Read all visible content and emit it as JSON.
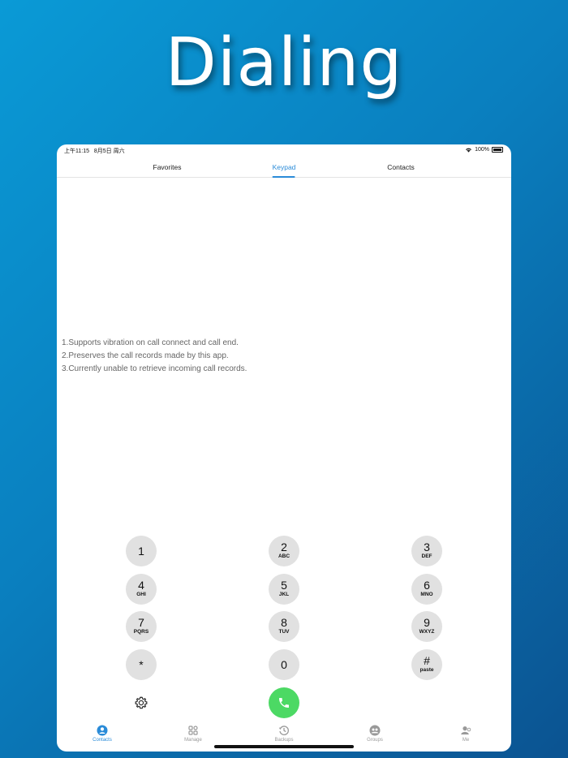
{
  "headline": "Dialing",
  "status": {
    "time": "上午11:15",
    "date": "8月5日 周六",
    "battery": "100%"
  },
  "tabs": [
    {
      "label": "Favorites",
      "active": false
    },
    {
      "label": "Keypad",
      "active": true
    },
    {
      "label": "Contacts",
      "active": false
    }
  ],
  "notes": [
    "1.Supports vibration on call connect and call end.",
    "2.Preserves the call records made by this app.",
    "3.Currently unable to retrieve incoming call records."
  ],
  "keypad": [
    {
      "digit": "1",
      "letters": ""
    },
    {
      "digit": "2",
      "letters": "ABC"
    },
    {
      "digit": "3",
      "letters": "DEF"
    },
    {
      "digit": "4",
      "letters": "GHI"
    },
    {
      "digit": "5",
      "letters": "JKL"
    },
    {
      "digit": "6",
      "letters": "MNO"
    },
    {
      "digit": "7",
      "letters": "PQRS"
    },
    {
      "digit": "8",
      "letters": "TUV"
    },
    {
      "digit": "9",
      "letters": "WXYZ"
    },
    {
      "digit": "*",
      "letters": ""
    },
    {
      "digit": "0",
      "letters": ""
    },
    {
      "digit": "#",
      "letters": "paste"
    }
  ],
  "tabbar": [
    {
      "label": "Contacts",
      "icon": "person-circle-icon",
      "active": true
    },
    {
      "label": "Manage",
      "icon": "grid-icon",
      "active": false
    },
    {
      "label": "Backups",
      "icon": "history-icon",
      "active": false
    },
    {
      "label": "Groups",
      "icon": "group-icon",
      "active": false
    },
    {
      "label": "Me",
      "icon": "person-badge-icon",
      "active": false
    }
  ],
  "colors": {
    "accent": "#2a8bd8",
    "call": "#4cd964",
    "key": "#e1e1e1"
  }
}
